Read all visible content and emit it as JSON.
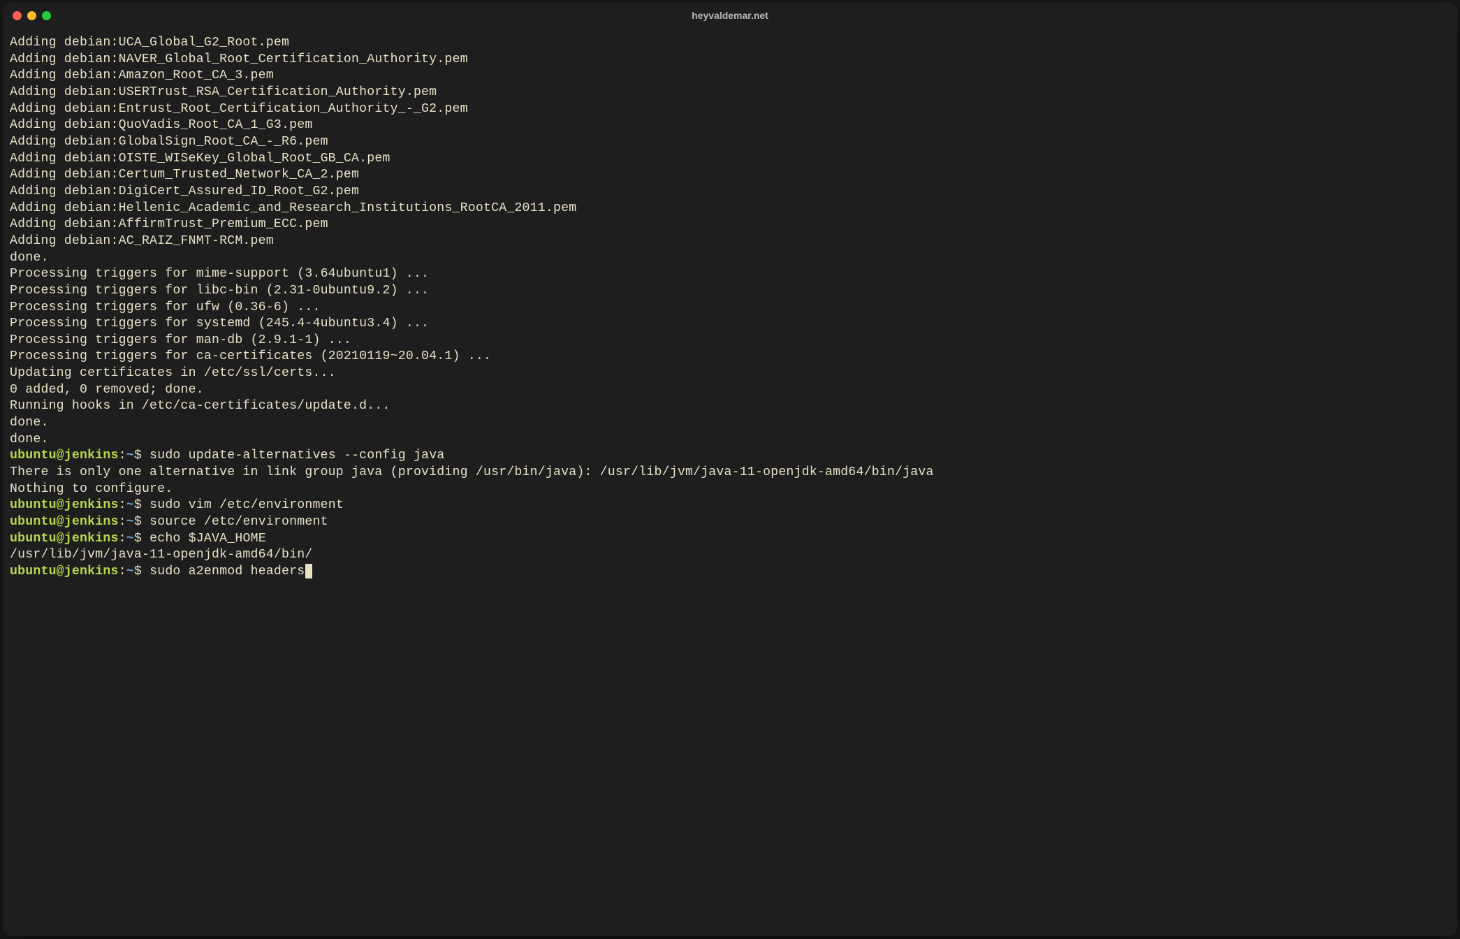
{
  "window": {
    "title": "heyvaldemar.net"
  },
  "colors": {
    "bg": "#1e1e1e",
    "text": "#e8e1c5",
    "promptUser": "#b6d94c",
    "promptPath": "#6aa7d6",
    "trafficRed": "#ff5f57",
    "trafficYellow": "#febc2e",
    "trafficGreen": "#28c840"
  },
  "prompt": {
    "userHost": "ubuntu@jenkins",
    "path": "~",
    "symbol": "$"
  },
  "output_lines": [
    "Adding debian:UCA_Global_G2_Root.pem",
    "Adding debian:NAVER_Global_Root_Certification_Authority.pem",
    "Adding debian:Amazon_Root_CA_3.pem",
    "Adding debian:USERTrust_RSA_Certification_Authority.pem",
    "Adding debian:Entrust_Root_Certification_Authority_-_G2.pem",
    "Adding debian:QuoVadis_Root_CA_1_G3.pem",
    "Adding debian:GlobalSign_Root_CA_-_R6.pem",
    "Adding debian:OISTE_WISeKey_Global_Root_GB_CA.pem",
    "Adding debian:Certum_Trusted_Network_CA_2.pem",
    "Adding debian:DigiCert_Assured_ID_Root_G2.pem",
    "Adding debian:Hellenic_Academic_and_Research_Institutions_RootCA_2011.pem",
    "Adding debian:AffirmTrust_Premium_ECC.pem",
    "Adding debian:AC_RAIZ_FNMT-RCM.pem",
    "done.",
    "Processing triggers for mime-support (3.64ubuntu1) ...",
    "Processing triggers for libc-bin (2.31-0ubuntu9.2) ...",
    "Processing triggers for ufw (0.36-6) ...",
    "Processing triggers for systemd (245.4-4ubuntu3.4) ...",
    "Processing triggers for man-db (2.9.1-1) ...",
    "Processing triggers for ca-certificates (20210119~20.04.1) ...",
    "Updating certificates in /etc/ssl/certs...",
    "0 added, 0 removed; done.",
    "Running hooks in /etc/ca-certificates/update.d...",
    "",
    "done.",
    "done."
  ],
  "history": [
    {
      "command": "sudo update-alternatives --config java",
      "output": [
        "There is only one alternative in link group java (providing /usr/bin/java): /usr/lib/jvm/java-11-openjdk-amd64/bin/java",
        "Nothing to configure."
      ]
    },
    {
      "command": "sudo vim /etc/environment",
      "output": []
    },
    {
      "command": "source /etc/environment",
      "output": []
    },
    {
      "command": "echo $JAVA_HOME",
      "output": [
        "/usr/lib/jvm/java-11-openjdk-amd64/bin/"
      ]
    }
  ],
  "current_command": "sudo a2enmod headers"
}
